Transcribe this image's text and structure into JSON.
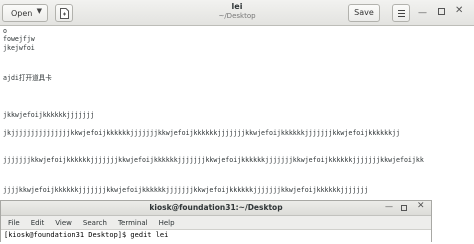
{
  "gedit": {
    "open_label": "Open",
    "title": "lei",
    "subtitle": "~/Desktop",
    "save_label": "Save",
    "icons": {
      "open_dropdown": "chevron-down-icon",
      "new_document": "new-document-icon",
      "menu": "hamburger-menu-icon",
      "minimize": "minimize-icon",
      "maximize": "maximize-icon",
      "close": "close-icon"
    }
  },
  "editor": {
    "lines": [
      "o",
      "fowejfjw",
      "jkejwfoi",
      "ajdi打开道具卡",
      "jkkwjefoijkkkkkkjjjjjjj",
      "jkjjjjjjjjjjjjjjjkkwjefoijkkkkkkjjjjjjjkkwjefoijkkkkkkjjjjjjjkkwjefoijkkkkkkjjjjjjjkkwjefoijkkkkkkjj",
      "jjjjjjjkkwjefoijkkkkkkjjjjjjjkkwjefoijkkkkkkjjjjjjjkkwjefoijkkkkkkjjjjjjjkkwjefoijkkkkkkjjjjjjjkkwjefoijkk",
      "jjjjkkwjefoijkkkkkkjjjjjjjkkwjefoijkkkkkkjjjjjjjkkwjefoijkkkkkkjjjjjjjkkwjefoijkkkkkkjjjjjjj"
    ]
  },
  "terminal": {
    "title": "kiosk@foundation31:~/Desktop",
    "menu": [
      "File",
      "Edit",
      "View",
      "Search",
      "Terminal",
      "Help"
    ],
    "prompt_line": "[kiosk@foundation31 Desktop]$ gedit lei"
  }
}
